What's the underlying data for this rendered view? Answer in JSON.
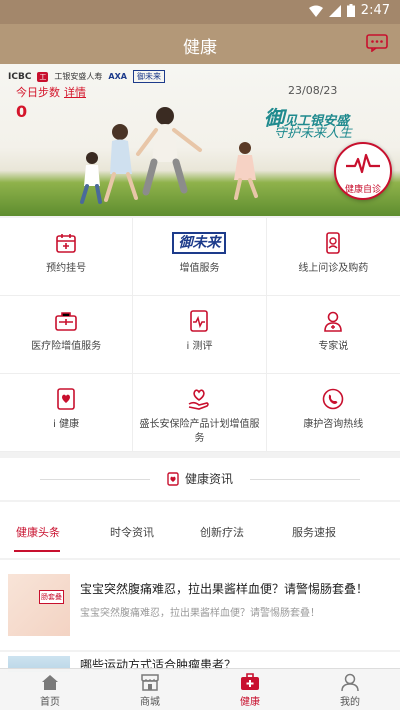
{
  "status_bar": {
    "time": "2:47"
  },
  "app_bar": {
    "title": "健康",
    "message_icon": "message-icon"
  },
  "banner": {
    "partner_logos": [
      "ICBC",
      "工银安盛人寿",
      "AXA",
      "御未来"
    ],
    "steps_label": "今日步数",
    "steps_detail": "详情",
    "steps_value": "0",
    "date": "23/08/23",
    "slogan_line1_prefix": "御",
    "slogan_line1": "见工银安盛",
    "slogan_line2": "守护未来人生",
    "self_check_label": "健康自诊"
  },
  "services": [
    {
      "label": "预约挂号",
      "icon": "calendar-plus-icon"
    },
    {
      "label": "增值服务",
      "icon": "yuweilai-logo"
    },
    {
      "label": "线上问诊及购药",
      "icon": "phone-doctor-icon"
    },
    {
      "label": "医疗险增值服务",
      "icon": "medical-kit-icon"
    },
    {
      "label": "i 测评",
      "icon": "pulse-icon"
    },
    {
      "label": "专家说",
      "icon": "doctor-icon"
    },
    {
      "label": "i 健康",
      "icon": "health-card-icon"
    },
    {
      "label": "盛长安保险产品计划增值服务",
      "icon": "heart-hand-icon"
    },
    {
      "label": "康护咨询热线",
      "icon": "hotline-icon"
    }
  ],
  "news": {
    "section_title": "健康资讯",
    "tabs": [
      "健康头条",
      "时令资讯",
      "创新疗法",
      "服务速报"
    ],
    "active_tab": "健康头条",
    "articles": [
      {
        "title": "宝宝突然腹痛难忍，拉出果酱样血便？请警惕肠套叠！",
        "summary": "宝宝突然腹痛难忍，拉出果酱样血便？请警惕肠套叠！",
        "thumb_tag": "肠套叠"
      },
      {
        "title": "哪些运动方式适合肿瘤患者？"
      }
    ]
  },
  "bottom_nav": [
    {
      "label": "首页",
      "icon": "home-icon"
    },
    {
      "label": "商城",
      "icon": "store-icon"
    },
    {
      "label": "健康",
      "icon": "health-kit-icon"
    },
    {
      "label": "我的",
      "icon": "profile-icon"
    }
  ],
  "colors": {
    "brand_red": "#c8102e",
    "appbar": "#b39878"
  }
}
